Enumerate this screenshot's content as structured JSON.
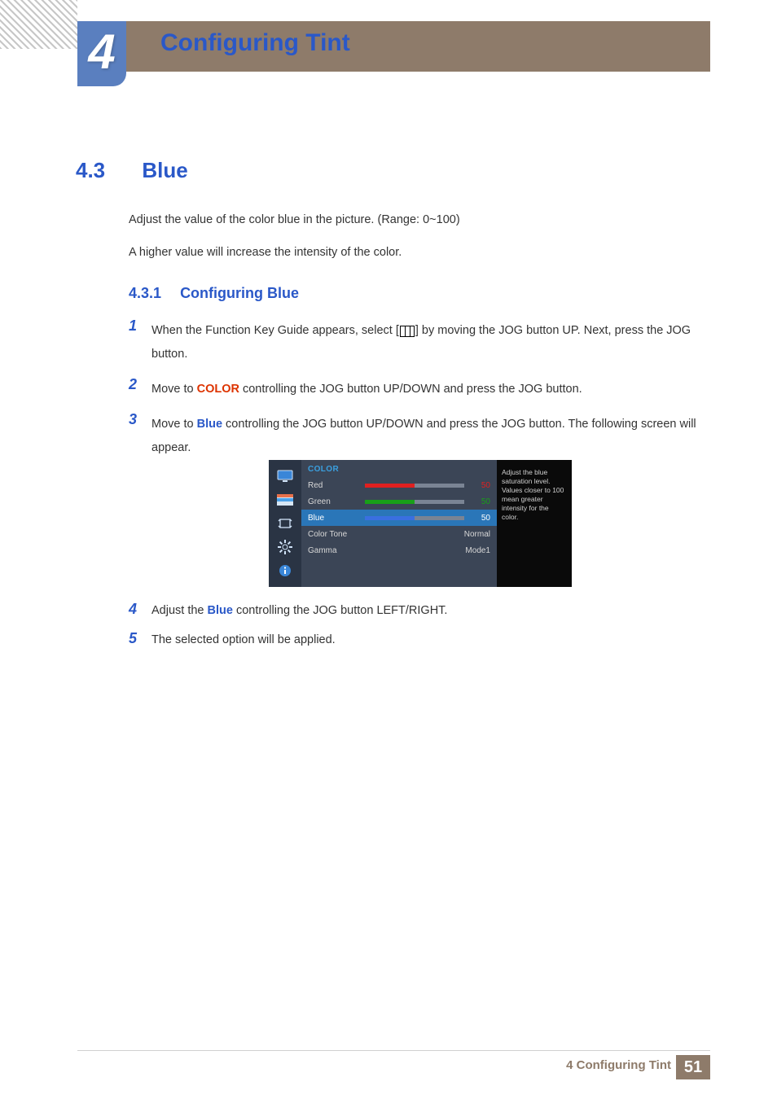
{
  "chapter": {
    "number": "4",
    "title": "Configuring Tint"
  },
  "section": {
    "number": "4.3",
    "name": "Blue"
  },
  "intro1": "Adjust the value of the color blue in the picture. (Range: 0~100)",
  "intro2": "A higher value will increase the intensity of the color.",
  "subsection": {
    "number": "4.3.1",
    "name": "Configuring Blue"
  },
  "steps": {
    "s1a": "When the Function Key Guide appears, select [",
    "s1b": "] by moving the JOG button UP. Next, press the JOG button.",
    "s2a": "Move to ",
    "s2kw": "COLOR",
    "s2b": " controlling the JOG button UP/DOWN and press the JOG button.",
    "s3a": "Move to ",
    "s3kw": "Blue",
    "s3b": " controlling the JOG button UP/DOWN and press the JOG button. The following screen will appear.",
    "s4a": "Adjust the ",
    "s4kw": "Blue",
    "s4b": " controlling the JOG button LEFT/RIGHT.",
    "s5": "The selected option will be applied."
  },
  "osd": {
    "title": "COLOR",
    "rows": [
      {
        "label": "Red",
        "val": "50",
        "fill": 50,
        "color": "#e02020",
        "valColor": "#e02020"
      },
      {
        "label": "Green",
        "val": "50",
        "fill": 50,
        "color": "#18a018",
        "valColor": "#18a018"
      },
      {
        "label": "Blue",
        "val": "50",
        "fill": 50,
        "color": "#3a6fe0",
        "valColor": "#ffffff",
        "selected": true
      }
    ],
    "textRows": [
      {
        "label": "Color Tone",
        "val": "Normal"
      },
      {
        "label": "Gamma",
        "val": "Mode1"
      }
    ],
    "help": "Adjust the blue saturation level. Values closer to 100 mean greater intensity for the color."
  },
  "footer": {
    "chapter": "4 Configuring Tint",
    "page": "51"
  }
}
